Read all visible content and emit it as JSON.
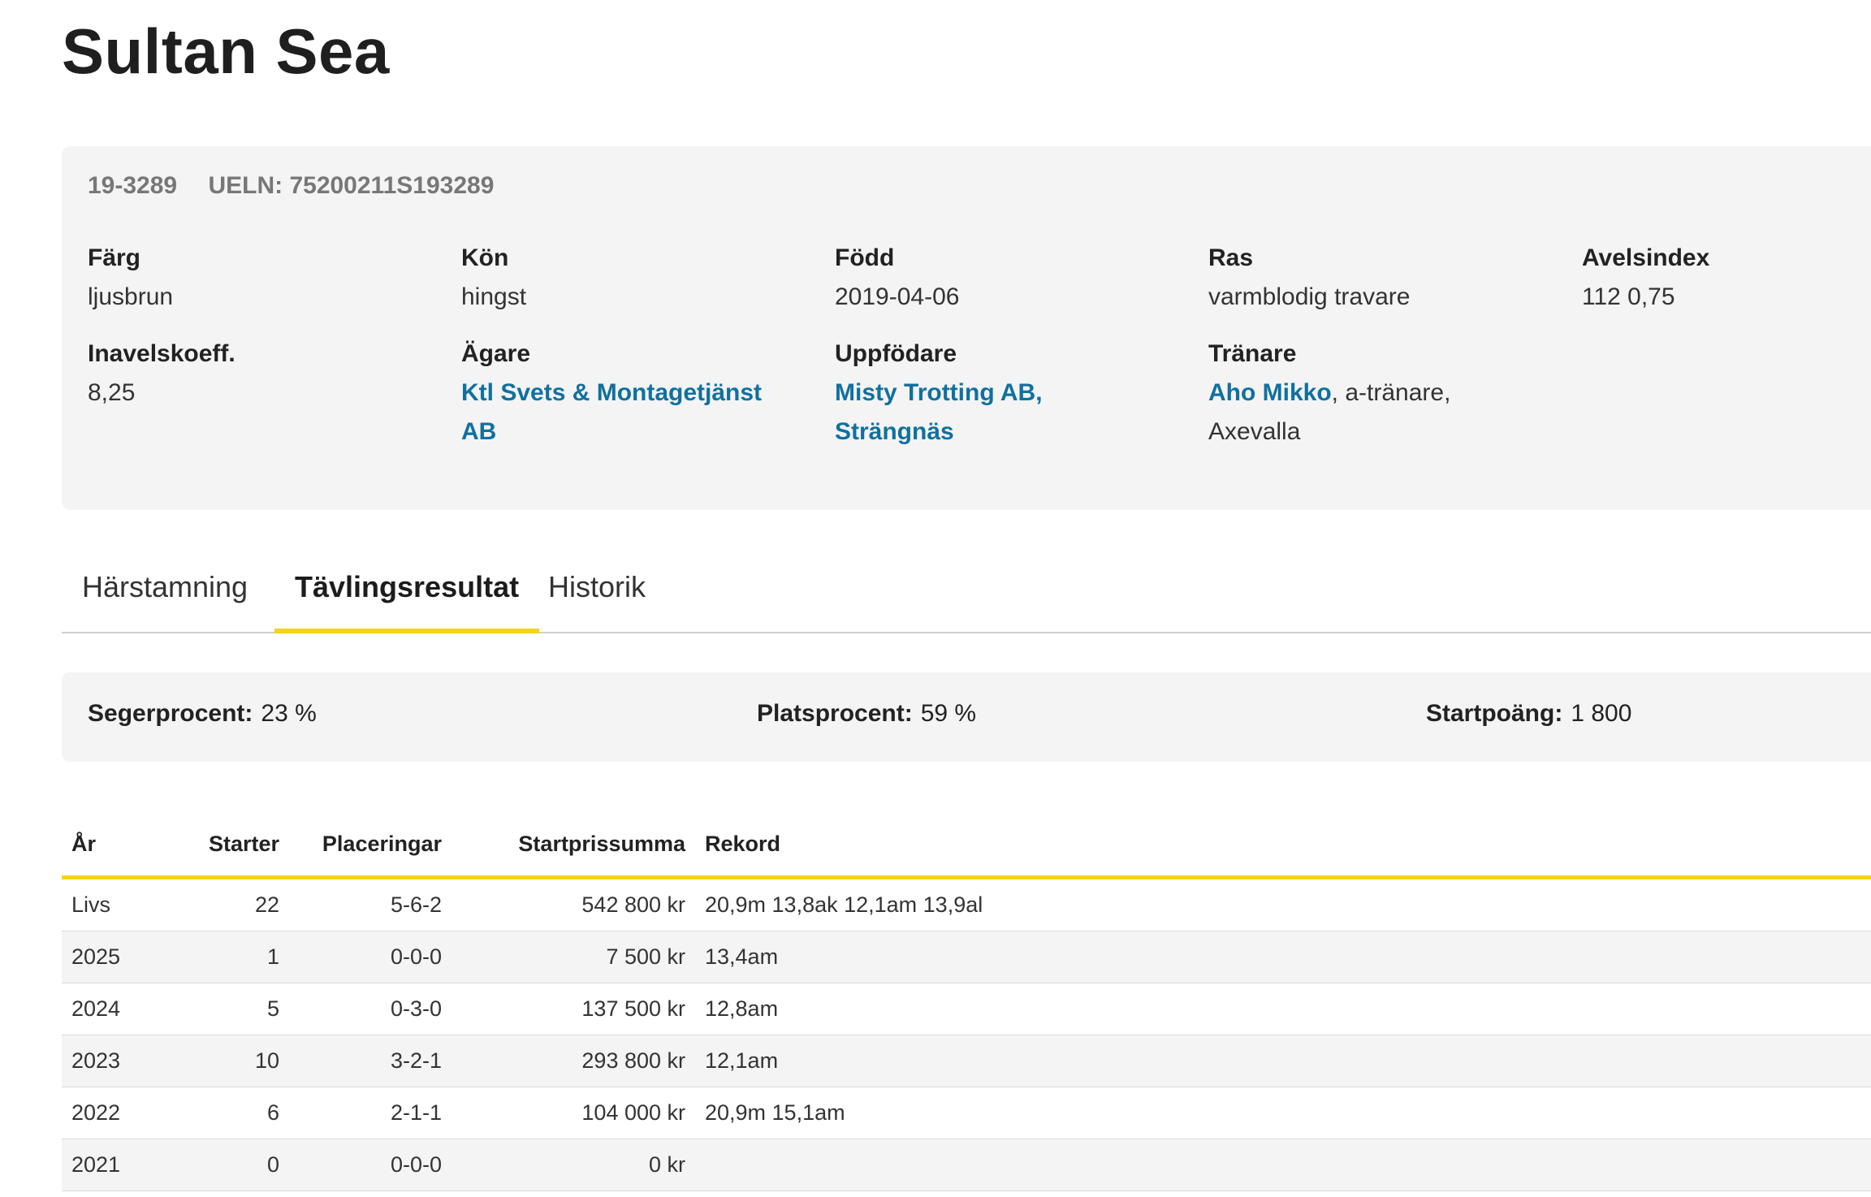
{
  "page_title": "Sultan Sea",
  "horse": {
    "reg_no": "19-3289",
    "ueln": "UELN: 75200211S193289"
  },
  "fields": {
    "farg_label": "Färg",
    "farg_value": "ljusbrun",
    "kon_label": "Kön",
    "kon_value": "hingst",
    "fodd_label": "Född",
    "fodd_value": "2019-04-06",
    "ras_label": "Ras",
    "ras_value": "varmblodig travare",
    "avels_label": "Avelsindex",
    "avels_value": "112 0,75",
    "inavel_label": "Inavelskoeff.",
    "inavel_value": "8,25",
    "agare_label": "Ägare",
    "agare_link": "Ktl Svets & Montagetjänst AB",
    "uppf_label": "Uppfödare",
    "uppf_link": "Misty Trotting AB, Strängnäs",
    "tranare_label": "Tränare",
    "tranare_link": "Aho Mikko",
    "tranare_rest": ", a-tränare, Axevalla"
  },
  "tabs": [
    "Härstamning",
    "Tävlingsresultat",
    "Historik"
  ],
  "active_tab": "Tävlingsresultat",
  "stats": {
    "seger_label": "Segerprocent:",
    "seger_value": "23 %",
    "plats_label": "Platsprocent:",
    "plats_value": "59 %",
    "start_label": "Startpoäng:",
    "start_value": "1 800"
  },
  "table": {
    "headers": [
      "År",
      "Starter",
      "Placeringar",
      "Startprissumma",
      "Rekord"
    ],
    "rows": [
      [
        "Livs",
        "22",
        "5-6-2",
        "542 800 kr",
        "20,9m 13,8ak 12,1am 13,9al"
      ],
      [
        "2025",
        "1",
        "0-0-0",
        "7 500 kr",
        "13,4am"
      ],
      [
        "2024",
        "5",
        "0-3-0",
        "137 500 kr",
        "12,8am"
      ],
      [
        "2023",
        "10",
        "3-2-1",
        "293 800 kr",
        "12,1am"
      ],
      [
        "2022",
        "6",
        "2-1-1",
        "104 000 kr",
        "20,9m 15,1am"
      ],
      [
        "2021",
        "0",
        "0-0-0",
        "0 kr",
        ""
      ]
    ]
  },
  "colors": {
    "accent": "#f5d315",
    "link": "#11709f",
    "panel": "#f4f4f4"
  }
}
